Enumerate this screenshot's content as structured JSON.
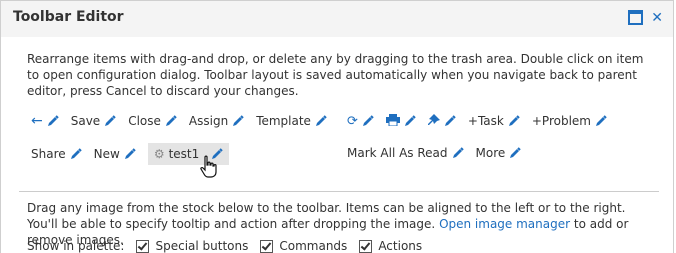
{
  "window": {
    "title": "Toolbar Editor",
    "description": "Rearrange items with drag-and drop, or delete any by dragging to the trash area. Double click on item to open configuration dialog. Toolbar layout is saved automatically when you navigate back to parent editor, press Cancel to discard your changes."
  },
  "toolbar": {
    "row1_left": [
      "Save",
      "Close",
      "Assign",
      "Template"
    ],
    "row1_right": [
      "+Task",
      "+Problem"
    ],
    "row2_left": [
      "Share",
      "New",
      "test1"
    ],
    "row2_right": [
      "Mark All As Read",
      "More"
    ]
  },
  "stock": {
    "text_before_link": "Drag any image from the stock below to the toolbar. Items can be aligned to the left or to the right. You'll be able to specify tooltip and action after dropping the image.",
    "link": "Open image manager",
    "text_after_link": "to add or remove images."
  },
  "palette": {
    "label": "Show in palette:",
    "options": [
      "Special buttons",
      "Commands",
      "Actions"
    ]
  },
  "colors": {
    "accent": "#1f6fbf",
    "titlebar": "#f4f4f4",
    "selected_item": "#e4e4e4"
  }
}
